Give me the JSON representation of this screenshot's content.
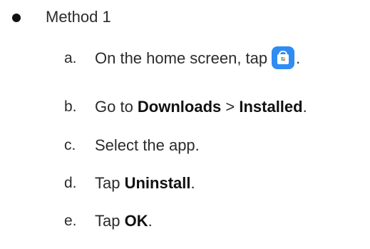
{
  "method": {
    "title": "Method 1"
  },
  "steps": [
    {
      "marker": "a.",
      "pre": "On the home screen, tap",
      "post": "."
    },
    {
      "marker": "b.",
      "pre": "Go to ",
      "bold1": "Downloads",
      "mid": " > ",
      "bold2": "Installed",
      "post": "."
    },
    {
      "marker": "c.",
      "pre": "Select the app."
    },
    {
      "marker": "d.",
      "pre": "Tap ",
      "bold1": "Uninstall",
      "post": "."
    },
    {
      "marker": "e.",
      "pre": "Tap ",
      "bold1": "OK",
      "post": "."
    }
  ],
  "icons": {
    "store": "app-store-bag-icon"
  },
  "colors": {
    "store_icon_bg": "#2f8cf2"
  }
}
